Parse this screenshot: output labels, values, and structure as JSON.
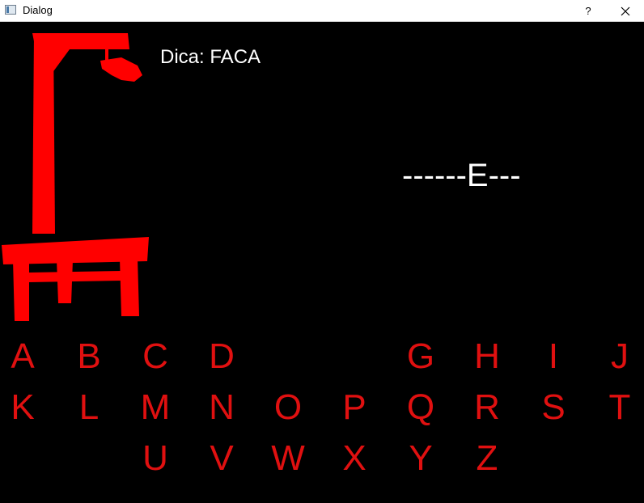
{
  "window": {
    "title": "Dialog",
    "help_label": "?",
    "close_icon": "close-icon",
    "app_icon": "window-icon"
  },
  "game": {
    "hint": "Dica: FACA",
    "word_display": "------E---",
    "gallows_color": "#ff0000",
    "letter_color": "#e01010",
    "letters": {
      "A": "A",
      "B": "B",
      "C": "C",
      "D": "D",
      "G": "G",
      "H": "H",
      "I": "I",
      "J": "J",
      "K": "K",
      "L": "L",
      "M": "M",
      "N": "N",
      "O": "O",
      "P": "P",
      "Q": "Q",
      "R": "R",
      "S": "S",
      "T": "T",
      "U": "U",
      "V": "V",
      "W": "W",
      "X": "X",
      "Y": "Y",
      "Z": "Z"
    }
  }
}
